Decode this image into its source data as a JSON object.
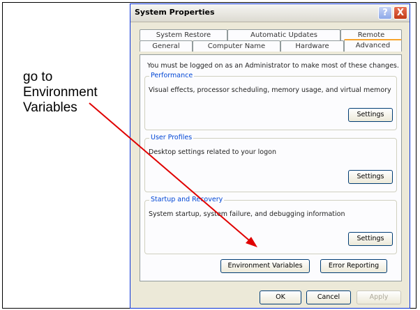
{
  "annotation": {
    "text": "go to\nEnvironment\nVariables"
  },
  "window": {
    "title": "System Properties",
    "help_label": "?",
    "close_label": "X"
  },
  "tabs": {
    "row1": [
      "System Restore",
      "Automatic Updates",
      "Remote"
    ],
    "row2": [
      "General",
      "Computer Name",
      "Hardware",
      "Advanced"
    ]
  },
  "panel": {
    "intro": "You must be logged on as an Administrator to make most of these changes.",
    "performance": {
      "title": "Performance",
      "desc": "Visual effects, processor scheduling, memory usage, and virtual memory",
      "button": "Settings"
    },
    "user_profiles": {
      "title": "User Profiles",
      "desc": "Desktop settings related to your logon",
      "button": "Settings"
    },
    "startup": {
      "title": "Startup and Recovery",
      "desc": "System startup, system failure, and debugging information",
      "button": "Settings"
    },
    "env_button": "Environment Variables",
    "error_button": "Error Reporting"
  },
  "footer": {
    "ok": "OK",
    "cancel": "Cancel",
    "apply": "Apply"
  },
  "colors": {
    "arrow": "#e00000",
    "accent": "#0046d5",
    "tab_highlight": "#f7a42c"
  }
}
